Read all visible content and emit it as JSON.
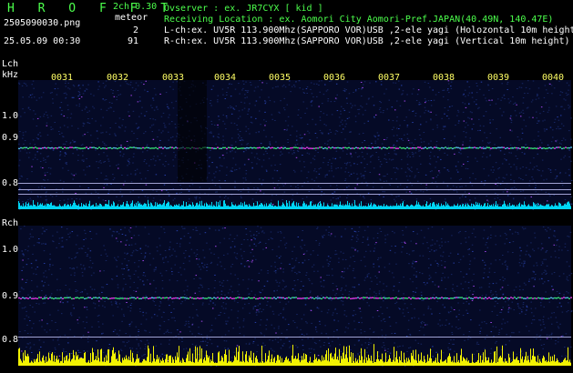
{
  "header": {
    "brand": "H R O F F T",
    "filename": "2505090030.png",
    "datetime": "25.05.09 00:30",
    "mode": "2ch 0.30",
    "meteor_label": "meteor",
    "lch_count": "2",
    "rch_count": "91",
    "observer": "Ovserver          : ex. JR7CYX [ kid ]",
    "location": "Receiving Location : ex. Aomori City Aomori-Pref.JAPAN(40.49N, 140.47E)",
    "lch_info": "L-ch:ex. UV5R 113.900Mhz(SAPPORO VOR)USB ,2-ele yagi (Holozontal 10m height)",
    "rch_info": "R-ch:ex. UV5R 113.900Mhz(SAPPORO VOR)USB ,2-ele yagi (Vertical 10m height)"
  },
  "lch_panel": {
    "title": "Lch",
    "unit": "kHz",
    "y_ticks": [
      "1.0",
      "0.9",
      "0.8"
    ],
    "x_ticks": [
      "0031",
      "0032",
      "0033",
      "0034",
      "0035",
      "0036",
      "0037",
      "0038",
      "0039",
      "0040"
    ]
  },
  "rch_panel": {
    "title": "Rch",
    "y_ticks": [
      "1.0",
      "0.9",
      "0.8"
    ]
  },
  "colors": {
    "background": "#000000",
    "noise": "#1a2a6a",
    "carrier": "#ff40ff",
    "level": "#ffff00",
    "baseline": "#00e0ff",
    "ticks": "#ffff66"
  }
}
